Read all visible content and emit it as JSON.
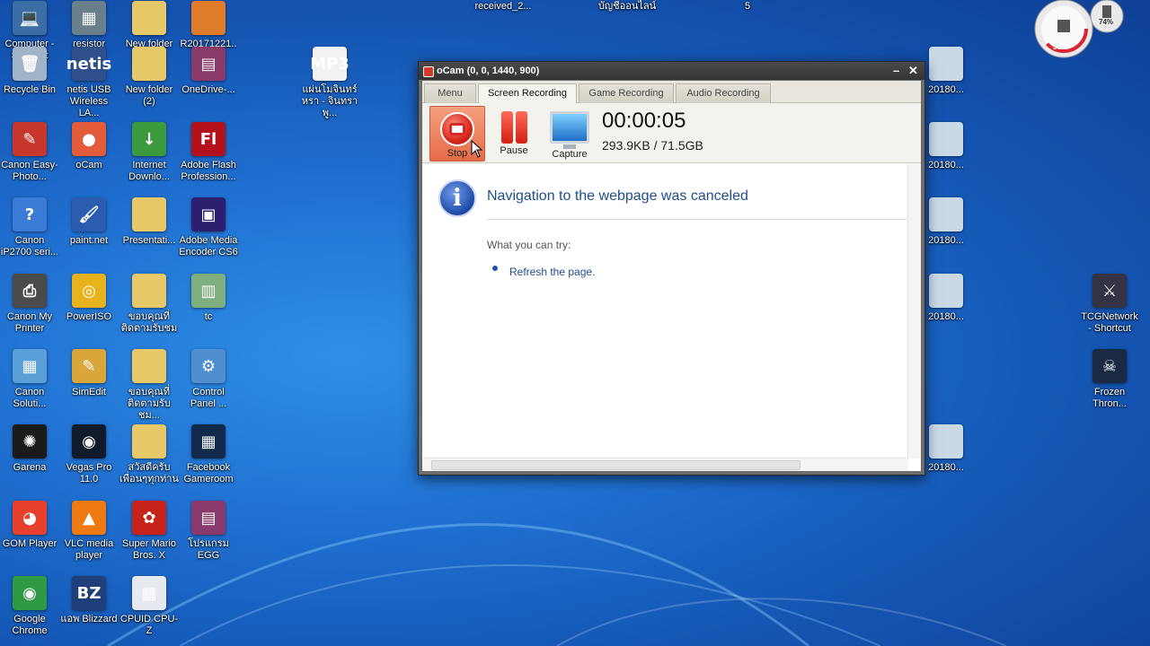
{
  "desktop": {
    "icons": [
      {
        "label": "Computer - Shortcut",
        "glyph": "💻",
        "bg": "#3a6ea5",
        "icon": "computer-icon"
      },
      {
        "label": "resistor",
        "glyph": "▦",
        "bg": "#6a7f8c",
        "icon": "resistor-icon"
      },
      {
        "label": "New folder",
        "glyph": "",
        "bg": "#e8c96a",
        "icon": "folder-icon"
      },
      {
        "label": "R20171221...",
        "glyph": "",
        "bg": "#e07b2a",
        "icon": "file-icon"
      },
      {
        "label": "Recycle Bin",
        "glyph": "🗑",
        "bg": "#9fb4c8",
        "icon": "recycle-bin-icon"
      },
      {
        "label": "netis USB Wireless LA...",
        "glyph": "netis",
        "bg": "#2f4f8a",
        "icon": "netis-icon"
      },
      {
        "label": "New folder (2)",
        "glyph": "",
        "bg": "#e8c96a",
        "icon": "folder-icon"
      },
      {
        "label": "OneDrive-...",
        "glyph": "▤",
        "bg": "#8a3a6a",
        "icon": "winrar-icon"
      },
      {
        "label": "แผ่นโมจินทร์หรา - จินทราพู...",
        "glyph": "MP3",
        "bg": "#f2f2f2",
        "icon": "mp3-file-icon"
      },
      {
        "label": "Canon Easy-Photo...",
        "glyph": "✎",
        "bg": "#c8372c",
        "icon": "canon-icon"
      },
      {
        "label": "oCam",
        "glyph": "●",
        "bg": "#e45b3a",
        "icon": "ocam-icon"
      },
      {
        "label": "Internet Downlo...",
        "glyph": "↓",
        "bg": "#3b9a3b",
        "icon": "idm-icon"
      },
      {
        "label": "Adobe Flash Profession...",
        "glyph": "Fl",
        "bg": "#b3111b",
        "icon": "adobe-flash-icon"
      },
      {
        "label": "Canon iP2700 seri...",
        "glyph": "?",
        "bg": "#3a7bd5",
        "icon": "help-icon"
      },
      {
        "label": "paint.net",
        "glyph": "🖌",
        "bg": "#2a5db0",
        "icon": "paintnet-icon"
      },
      {
        "label": "Presentati...",
        "glyph": "",
        "bg": "#e8c96a",
        "icon": "folder-icon"
      },
      {
        "label": "Adobe Media Encoder CS6",
        "glyph": "▣",
        "bg": "#2b1f6e",
        "icon": "media-encoder-icon"
      },
      {
        "label": "Canon My Printer",
        "glyph": "⎙",
        "bg": "#4a4a4a",
        "icon": "printer-icon"
      },
      {
        "label": "PowerISO",
        "glyph": "◎",
        "bg": "#e8b21c",
        "icon": "poweriso-icon"
      },
      {
        "label": "ขอบคุณที่ติดตามรับชม",
        "glyph": "",
        "bg": "#e8c96a",
        "icon": "folder-icon"
      },
      {
        "label": "tc",
        "glyph": "▥",
        "bg": "#7fae7f",
        "icon": "image-file-icon"
      },
      {
        "label": "Canon Soluti...",
        "glyph": "▦",
        "bg": "#5aa0d8",
        "icon": "canon-solution-icon"
      },
      {
        "label": "SimEdit",
        "glyph": "✎",
        "bg": "#d9a63a",
        "icon": "simedit-icon"
      },
      {
        "label": "ขอบคุณที่ติดตามรับชม...",
        "glyph": "",
        "bg": "#e8c96a",
        "icon": "folder-icon"
      },
      {
        "label": "Control Panel ...",
        "glyph": "⚙",
        "bg": "#4f8fd0",
        "icon": "control-panel-icon"
      },
      {
        "label": "Garena",
        "glyph": "✺",
        "bg": "#1a1a1a",
        "icon": "garena-icon"
      },
      {
        "label": "Vegas Pro 11.0",
        "glyph": "◉",
        "bg": "#101a2a",
        "icon": "vegas-icon"
      },
      {
        "label": "สวัสดีครับเพื่อนๆทุกท่าน",
        "glyph": "",
        "bg": "#e8c96a",
        "icon": "folder-icon"
      },
      {
        "label": "Facebook Gameroom",
        "glyph": "▦",
        "bg": "#0f2a4a",
        "icon": "gameroom-icon"
      },
      {
        "label": "GOM Player",
        "glyph": "◕",
        "bg": "#e8402c",
        "icon": "gom-icon"
      },
      {
        "label": "VLC media player",
        "glyph": "▲",
        "bg": "#f07a12",
        "icon": "vlc-icon"
      },
      {
        "label": "Super Mario Bros. X",
        "glyph": "✿",
        "bg": "#c8231a",
        "icon": "mario-icon"
      },
      {
        "label": "โปรแกรม EGG",
        "glyph": "▤",
        "bg": "#8a3a6a",
        "icon": "winrar-icon"
      },
      {
        "label": "Google Chrome",
        "glyph": "◉",
        "bg": "#2f9a44",
        "icon": "chrome-icon"
      },
      {
        "label": "แอพ Blizzard",
        "glyph": "BZ",
        "bg": "#1e3f7a",
        "icon": "blizzard-icon"
      },
      {
        "label": "CPUID CPU-Z",
        "glyph": "▦",
        "bg": "#e6eaf0",
        "icon": "cpuz-icon"
      },
      {
        "label": "received_2...",
        "glyph": "",
        "bg": "#333",
        "icon": "image-file-icon"
      },
      {
        "label": "บัญชีออนไลน์",
        "glyph": "",
        "bg": "#f2f2f2",
        "icon": "document-icon"
      },
      {
        "label": "5",
        "glyph": "",
        "bg": "#222",
        "icon": "image-file-icon"
      },
      {
        "label": "TCGNetwork - Shortcut",
        "glyph": "⚔",
        "bg": "#334",
        "icon": "tcg-icon"
      },
      {
        "label": "Frozen Thron...",
        "glyph": "☠",
        "bg": "#1b2a44",
        "icon": "frozen-throne-icon"
      },
      {
        "label": "20180...",
        "glyph": "",
        "bg": "#c9d9e6",
        "icon": "image-file-icon"
      },
      {
        "label": "20180...",
        "glyph": "",
        "bg": "#c9d9e6",
        "icon": "image-file-icon"
      },
      {
        "label": "20180...",
        "glyph": "",
        "bg": "#c9d9e6",
        "icon": "image-file-icon"
      },
      {
        "label": "20180...",
        "glyph": "",
        "bg": "#c9d9e6",
        "icon": "image-file-icon"
      },
      {
        "label": "20180...",
        "glyph": "",
        "bg": "#c9d9e6",
        "icon": "image-file-icon"
      }
    ]
  },
  "gadget": {
    "cpu": "36%",
    "mem": "74%"
  },
  "ocam": {
    "title": "oCam (0, 0, 1440, 900)",
    "tabs": [
      "Menu",
      "Screen Recording",
      "Game Recording",
      "Audio Recording"
    ],
    "active_tab": "Screen Recording",
    "buttons": {
      "stop": "Stop",
      "pause": "Pause",
      "capture": "Capture"
    },
    "timer": "00:00:05",
    "size": "293.9KB / 71.5GB"
  },
  "browser": {
    "error_title": "Navigation to the webpage was canceled",
    "what_you_can_try": "What you can try:",
    "suggestion": "Refresh the page."
  }
}
